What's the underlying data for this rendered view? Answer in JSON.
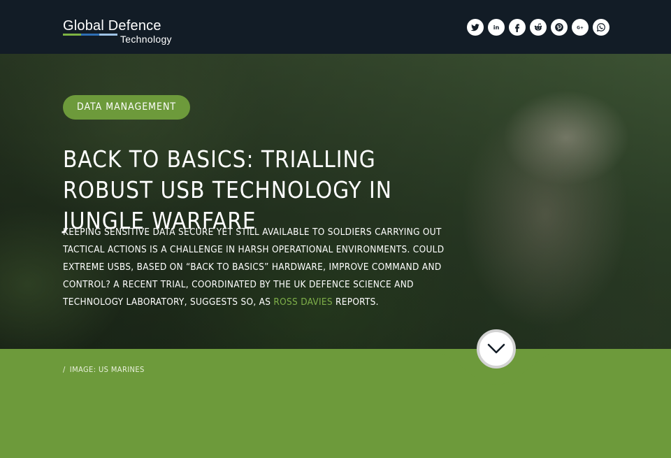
{
  "colors": {
    "header_bg": "#121c26",
    "accent_green": "#6d9a3b",
    "link_green": "#7fb04a",
    "logo_bar_green": "#7db343",
    "logo_bar_blue": "#2f6fb5",
    "logo_bar_light": "#9fc3e6"
  },
  "header": {
    "logo": {
      "line1": "Global Defence",
      "line2": "Technology"
    },
    "social_icons": [
      "twitter-icon",
      "linkedin-icon",
      "facebook-icon",
      "reddit-icon",
      "pinterest-icon",
      "google-plus-icon",
      "whatsapp-icon"
    ],
    "social_labels": {
      "linkedin": "in",
      "googleplus": "G+"
    }
  },
  "hero": {
    "category": "DATA MANAGEMENT",
    "title": "BACK TO BASICS: TRIALLING ROBUST USB TECHNOLOGY IN JUNGLE WARFARE",
    "summary_text": "KEEPING SENSITIVE DATA SECURE YET STILL AVAILABLE TO SOLDIERS CARRYING OUT TACTICAL ACTIONS IS A CHALLENGE IN HARSH OPERATIONAL ENVIRONMENTS. COULD EXTREME USBS, BASED ON “BACK TO BASICS” HARDWARE, IMPROVE COMMAND AND CONTROL? A RECENT TRIAL, COORDINATED BY THE UK DEFENCE SCIENCE AND TECHNOLOGY LABORATORY, SUGGESTS SO, AS ",
    "author": "ROSS DAVIES",
    "summary_end": " REPORTS."
  },
  "scroll_button": {
    "icon": "chevron-down-icon"
  },
  "caption": {
    "separator": "/",
    "text": "IMAGE: US MARINES"
  }
}
